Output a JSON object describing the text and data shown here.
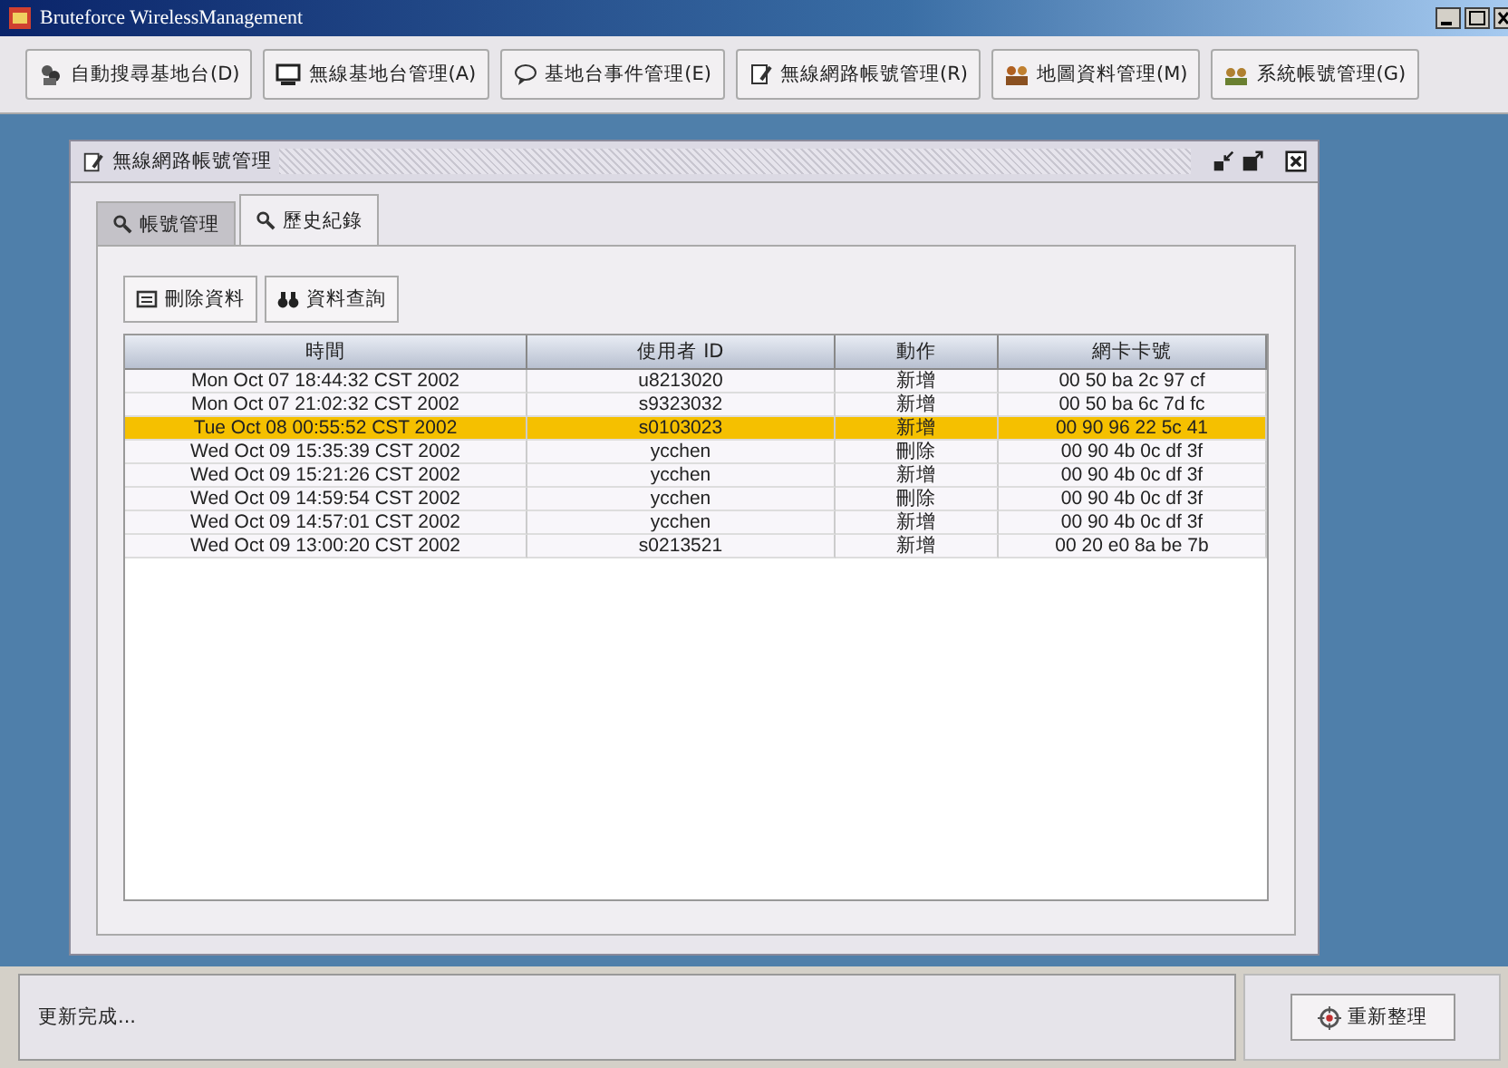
{
  "window": {
    "title": "Bruteforce WirelessManagement"
  },
  "toolbar": [
    {
      "label": "自動搜尋基地台(D)",
      "kind": "search"
    },
    {
      "label": "無線基地台管理(A)",
      "kind": "monitor"
    },
    {
      "label": "基地台事件管理(E)",
      "kind": "bubble"
    },
    {
      "label": "無線網路帳號管理(R)",
      "kind": "note"
    },
    {
      "label": "地圖資料管理(M)",
      "kind": "map"
    },
    {
      "label": "系統帳號管理(G)",
      "kind": "users"
    }
  ],
  "inner_window": {
    "title": "無線網路帳號管理"
  },
  "tabs": [
    {
      "label": "帳號管理",
      "selected": false
    },
    {
      "label": "歷史紀錄",
      "selected": true
    }
  ],
  "actions": [
    {
      "label": "刪除資料",
      "kind": "delete"
    },
    {
      "label": "資料查詢",
      "kind": "find"
    }
  ],
  "table": {
    "columns": [
      "時間",
      "使用者 ID",
      "動作",
      "網卡卡號"
    ],
    "rows": [
      {
        "cells": [
          "Mon Oct 07 18:44:32 CST 2002",
          "u8213020",
          "新增",
          "00 50 ba 2c 97 cf"
        ],
        "selected": false
      },
      {
        "cells": [
          "Mon Oct 07 21:02:32 CST 2002",
          "s9323032",
          "新增",
          "00 50 ba 6c 7d fc"
        ],
        "selected": false
      },
      {
        "cells": [
          "Tue Oct 08 00:55:52 CST 2002",
          "s0103023",
          "新增",
          "00 90 96 22 5c 41"
        ],
        "selected": true
      },
      {
        "cells": [
          "Wed Oct 09 15:35:39 CST 2002",
          "ycchen",
          "刪除",
          "00 90 4b 0c df 3f"
        ],
        "selected": false
      },
      {
        "cells": [
          "Wed Oct 09 15:21:26 CST 2002",
          "ycchen",
          "新增",
          "00 90 4b 0c df 3f"
        ],
        "selected": false
      },
      {
        "cells": [
          "Wed Oct 09 14:59:54 CST 2002",
          "ycchen",
          "刪除",
          "00 90 4b 0c df 3f"
        ],
        "selected": false
      },
      {
        "cells": [
          "Wed Oct 09 14:57:01 CST 2002",
          "ycchen",
          "新增",
          "00 90 4b 0c df 3f"
        ],
        "selected": false
      },
      {
        "cells": [
          "Wed Oct 09 13:00:20 CST 2002",
          "s0213521",
          "新增",
          "00 20 e0 8a be 7b"
        ],
        "selected": false
      }
    ]
  },
  "status_bar": {
    "message": "更新完成...",
    "button": "重新整理"
  }
}
